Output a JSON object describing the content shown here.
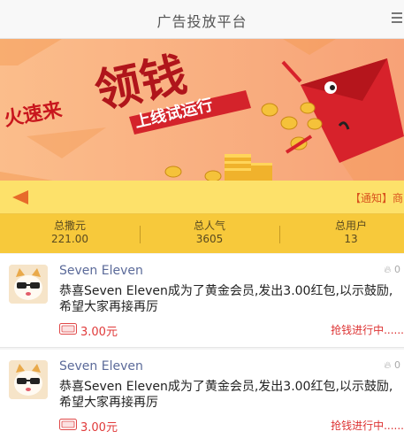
{
  "header": {
    "title": "广告投放平台",
    "menu_icon": "menu-icon"
  },
  "banner": {
    "headline": "火速来领钱",
    "headline_small": "火速来",
    "headline_big": "领钱",
    "subline": "上线试运行",
    "colors": {
      "bg": "#f8b27f",
      "red": "#d4232b",
      "gold": "#f7c744"
    }
  },
  "notice": {
    "icon": "speaker-icon",
    "text": "【通知】商"
  },
  "stats": [
    {
      "label": "总撒元",
      "value": "221.00"
    },
    {
      "label": "总人气",
      "value": "3605"
    },
    {
      "label": "总用户",
      "value": "13"
    }
  ],
  "feed": [
    {
      "name": "Seven Eleven",
      "likes": "0",
      "message": "恭喜Seven Eleven成为了黄金会员,发出3.00红包,以示鼓励,希望大家再接再厉",
      "amount": "3.00元",
      "status": "抢钱进行中......"
    },
    {
      "name": "Seven Eleven",
      "likes": "0",
      "message": "恭喜Seven Eleven成为了黄金会员,发出3.00红包,以示鼓励,希望大家再接再厉",
      "amount": "3.00元",
      "status": "抢钱进行中......"
    }
  ]
}
